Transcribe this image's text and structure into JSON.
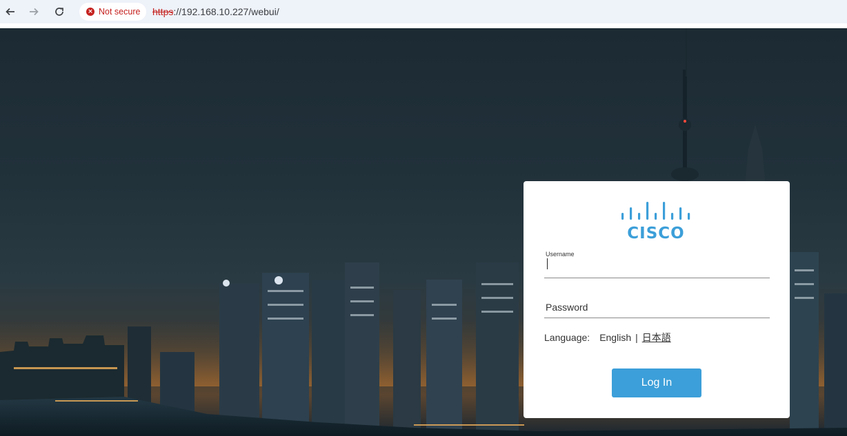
{
  "browser": {
    "security_chip": "Not secure",
    "url_scheme": "https",
    "url_rest": "://192.168.10.227/webui/"
  },
  "login": {
    "brand": "CISCO",
    "username_label": "Username",
    "username_value": "",
    "password_placeholder": "Password",
    "language_label": "Language:",
    "language_options": [
      "English",
      "日本語"
    ],
    "language_separator": "|",
    "login_button": "Log In"
  },
  "colors": {
    "cisco_blue": "#3c9fd9",
    "insecure_red": "#c5221f"
  }
}
